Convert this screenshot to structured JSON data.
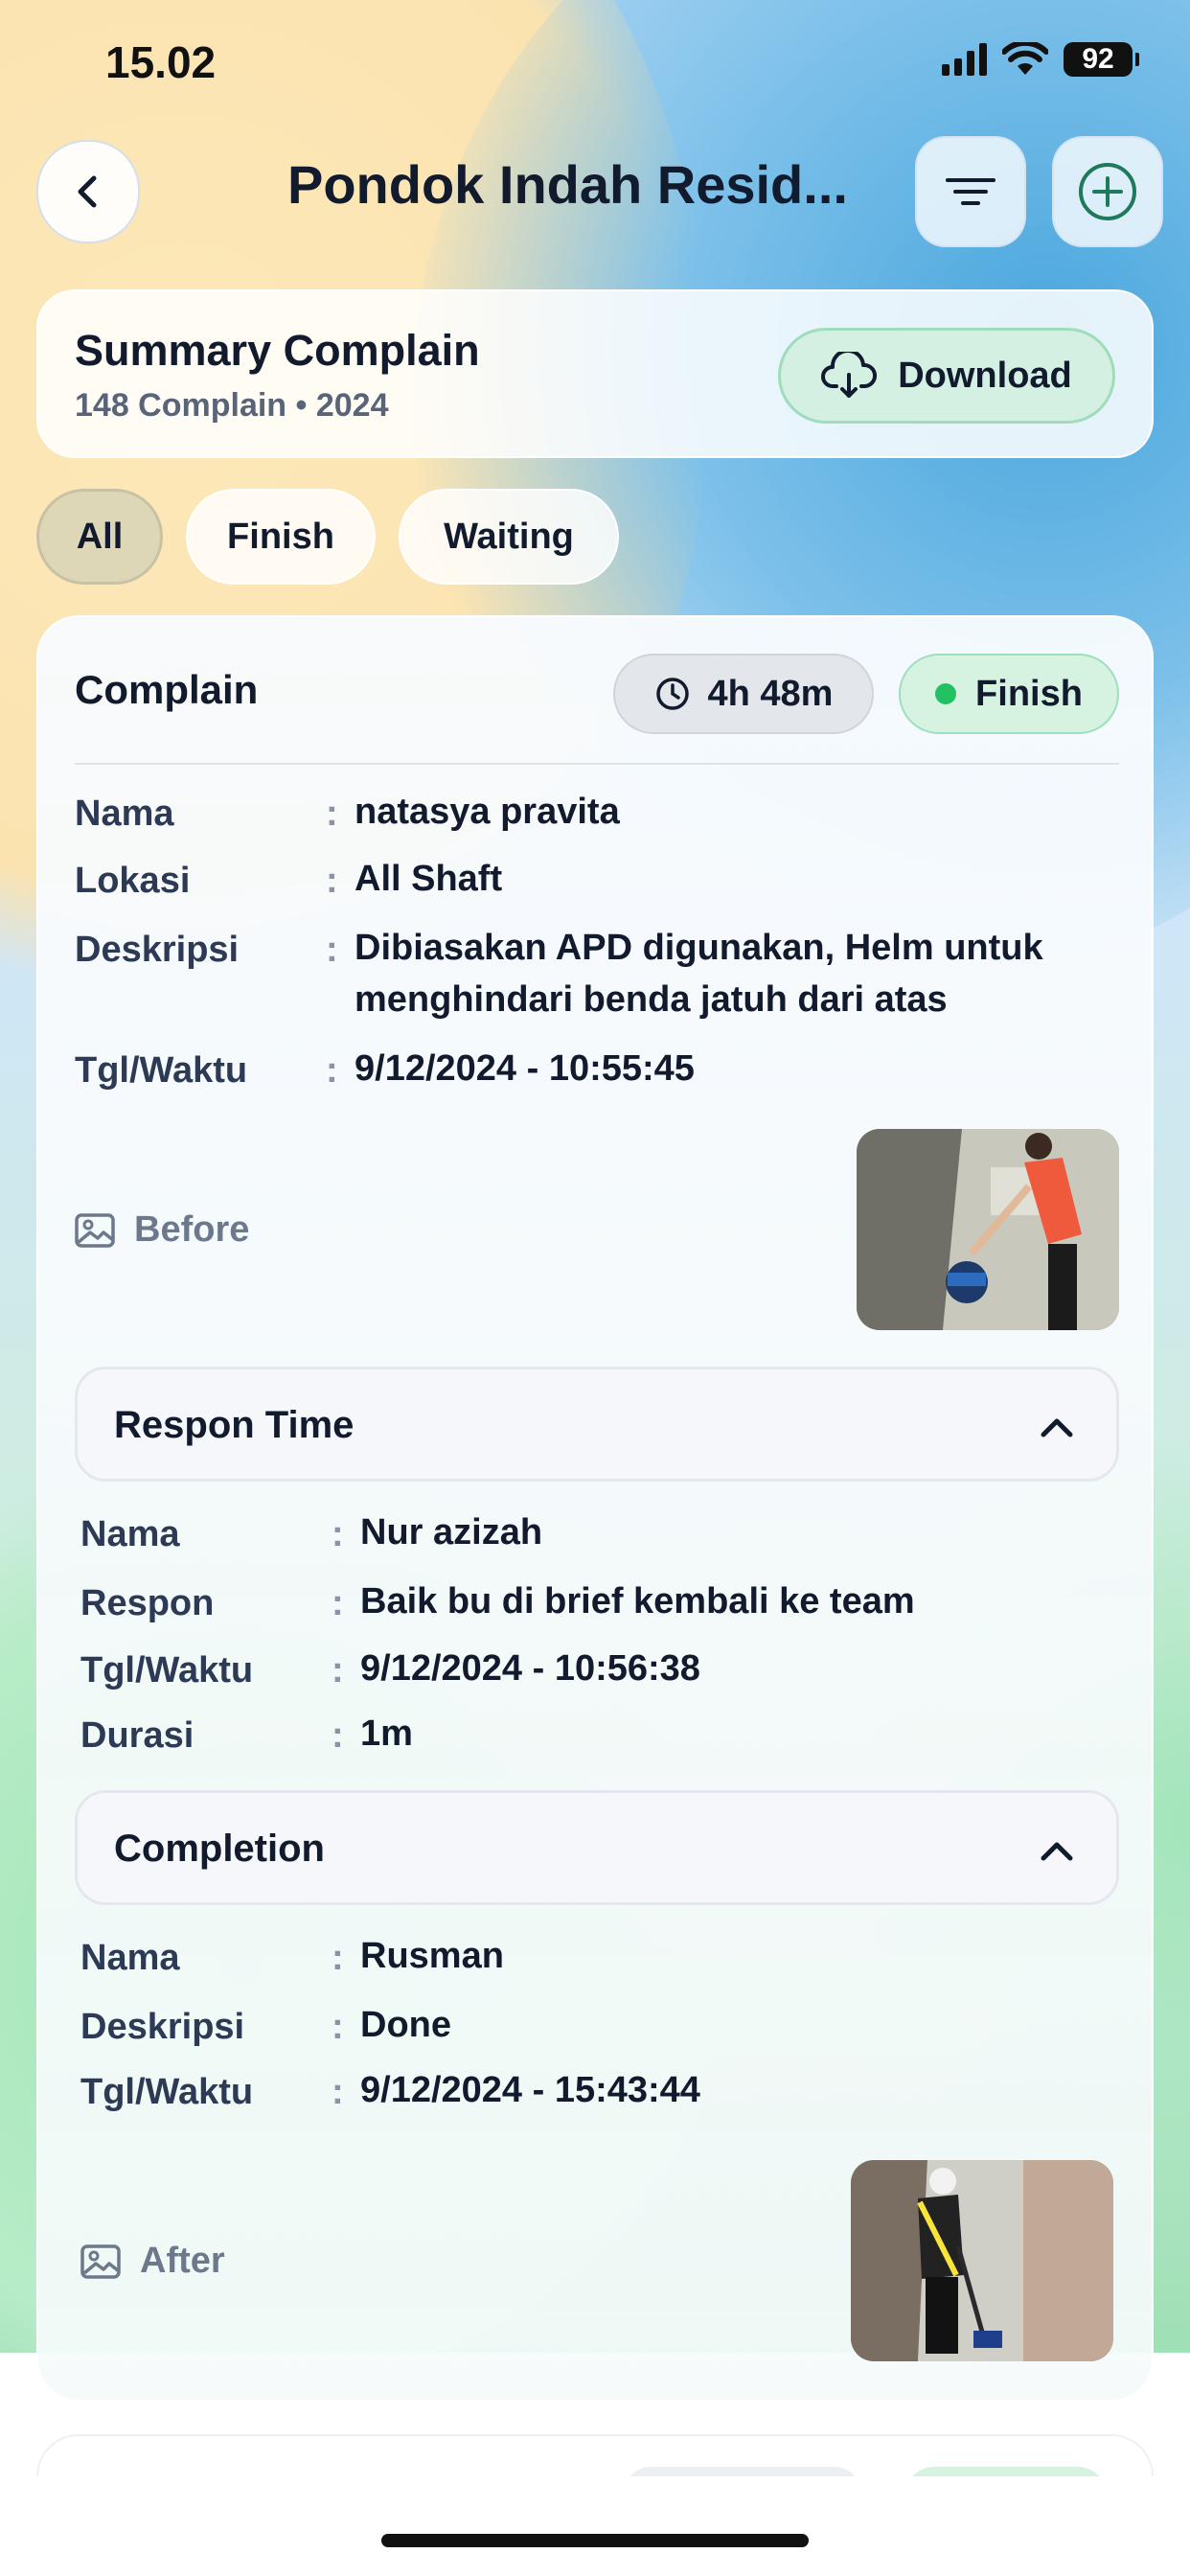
{
  "status_bar": {
    "time": "15.02",
    "battery": "92"
  },
  "header": {
    "title": "Pondok Indah Resid..."
  },
  "summary": {
    "title": "Summary Complain",
    "subtitle": "148 Complain • 2024",
    "download_label": "Download"
  },
  "filters": [
    {
      "label": "All",
      "active": true
    },
    {
      "label": "Finish",
      "active": false
    },
    {
      "label": "Waiting",
      "active": false
    }
  ],
  "complaint": {
    "title": "Complain",
    "duration": "4h 48m",
    "status": "Finish",
    "separator": ":",
    "fields": [
      {
        "key": "Nama",
        "value": "natasya pravita"
      },
      {
        "key": "Lokasi",
        "value": "All Shaft"
      },
      {
        "key": "Deskripsi",
        "value": "Dibiasakan APD digunakan, Helm untuk menghindari benda jatuh dari atas"
      },
      {
        "key": "Tgl/Waktu",
        "value": "9/12/2024 - 10:55:45"
      }
    ],
    "before_label": "Before",
    "response": {
      "title": "Respon Time",
      "fields": [
        {
          "key": "Nama",
          "value": "Nur azizah"
        },
        {
          "key": "Respon",
          "value": "Baik bu di brief kembali ke team"
        },
        {
          "key": "Tgl/Waktu",
          "value": "9/12/2024 - 10:56:38"
        },
        {
          "key": "Durasi",
          "value": "1m"
        }
      ]
    },
    "completion": {
      "title": "Completion",
      "fields": [
        {
          "key": "Nama",
          "value": "Rusman"
        },
        {
          "key": "Deskripsi",
          "value": "Done"
        },
        {
          "key": "Tgl/Waktu",
          "value": "9/12/2024 - 15:43:44"
        }
      ]
    },
    "after_label": "After"
  },
  "colors": {
    "accent_green": "#22c164",
    "status_bg": "#d6f3e2",
    "download_bg": "#d4f0e3",
    "active_pill": "#ddd7b8",
    "text_dark": "#121a2e"
  },
  "icons": {
    "back": "chevron-left-icon",
    "filter": "filter-lines-icon",
    "add": "plus-circle-icon",
    "download": "cloud-download-icon",
    "clock": "clock-icon",
    "image": "image-icon",
    "collapse": "chevron-up-icon"
  }
}
